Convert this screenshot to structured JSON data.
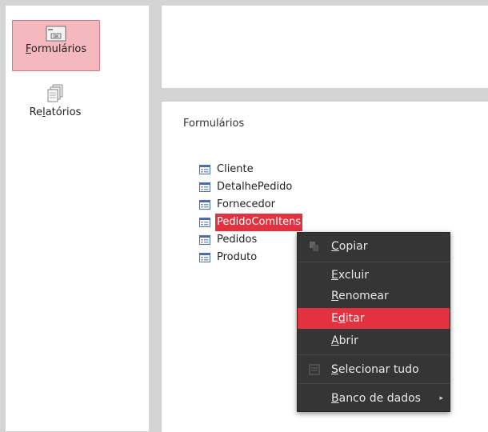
{
  "sidebar": {
    "items": [
      {
        "label": "Formulários",
        "accel": "F",
        "rest": "ormulários"
      },
      {
        "label": "Relatórios",
        "pre": "Re",
        "accel": "l",
        "rest": "atórios"
      }
    ]
  },
  "panel": {
    "title": "Formulários",
    "items": [
      "Cliente",
      "DetalhePedido",
      "Fornecedor",
      "PedidoComItens",
      "Pedidos",
      "Produto"
    ],
    "selected": "PedidoComItens"
  },
  "context_menu": {
    "copy": {
      "accel": "C",
      "rest": "opiar"
    },
    "delete": {
      "accel": "E",
      "rest": "xcluir"
    },
    "rename": {
      "accel": "R",
      "rest": "enomear"
    },
    "edit": {
      "pre": "E",
      "accel": "d",
      "rest": "itar"
    },
    "open": {
      "accel": "A",
      "rest": "brir"
    },
    "select_all": {
      "accel": "S",
      "rest": "elecionar tudo"
    },
    "database": {
      "accel": "B",
      "rest": "anco de dados"
    }
  },
  "colors": {
    "accent": "#e2313f",
    "selected_bg": "#f5b8bf",
    "menu_bg": "#353535"
  },
  "icons": {
    "forms": "form-ok-icon",
    "reports": "reports-stack-icon",
    "form_item": "form-document-icon"
  }
}
